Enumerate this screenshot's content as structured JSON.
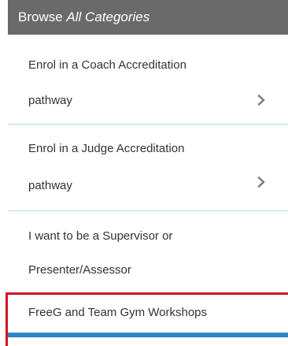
{
  "header": {
    "prefix": "Browse ",
    "emphasis": "All Categories"
  },
  "items": [
    {
      "line1": "Enrol in a Coach Accreditation",
      "line2": "pathway",
      "chevron": "chevron-right-icon"
    },
    {
      "line1": "Enrol in a Judge Accreditation",
      "line2": "pathway",
      "chevron": "chevron-right-icon"
    },
    {
      "line1": "I want to be a Supervisor or",
      "line2": "Presenter/Assessor"
    },
    {
      "line1": "FreeG and Team Gym Workshops"
    }
  ],
  "colors": {
    "header_bg": "#6a6a6a",
    "divider": "#b8d7ea",
    "highlight_border": "#d6121f",
    "active_bar": "#2f86c8"
  }
}
